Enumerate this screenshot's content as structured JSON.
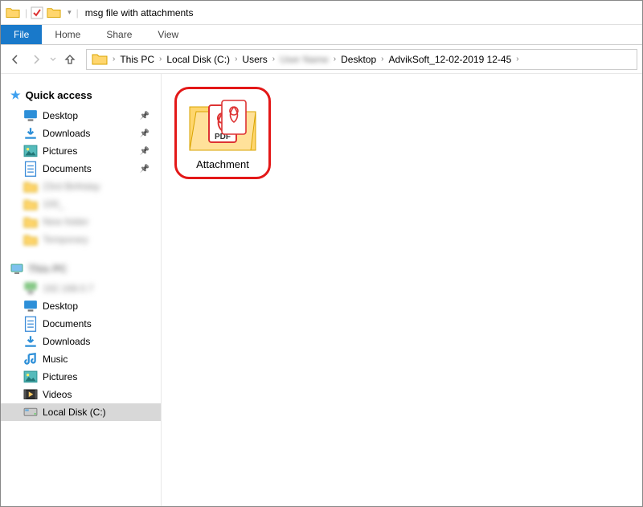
{
  "window": {
    "title": "msg file with attachments"
  },
  "ribbon": {
    "file": "File",
    "tabs": [
      "Home",
      "Share",
      "View"
    ]
  },
  "breadcrumbs": [
    {
      "label": "This PC",
      "blurred": false
    },
    {
      "label": "Local Disk (C:)",
      "blurred": false
    },
    {
      "label": "Users",
      "blurred": false
    },
    {
      "label": "User Name",
      "blurred": true
    },
    {
      "label": "Desktop",
      "blurred": false
    },
    {
      "label": "AdvikSoft_12-02-2019 12-45",
      "blurred": false
    }
  ],
  "sidebar": {
    "quick_access": {
      "title": "Quick access",
      "items": [
        {
          "label": "Desktop",
          "icon": "monitor",
          "pinned": true,
          "blurred": false
        },
        {
          "label": "Downloads",
          "icon": "download",
          "pinned": true,
          "blurred": false
        },
        {
          "label": "Pictures",
          "icon": "pictures",
          "pinned": true,
          "blurred": false
        },
        {
          "label": "Documents",
          "icon": "documents",
          "pinned": true,
          "blurred": false
        },
        {
          "label": "23rd Birthday",
          "icon": "folder",
          "pinned": false,
          "blurred": true
        },
        {
          "label": "100_",
          "icon": "folder",
          "pinned": false,
          "blurred": true
        },
        {
          "label": "New folder",
          "icon": "folder",
          "pinned": false,
          "blurred": true
        },
        {
          "label": "Temporary",
          "icon": "folder",
          "pinned": false,
          "blurred": true
        }
      ]
    },
    "this_pc": {
      "title": "This PC",
      "blurred_title": true,
      "items": [
        {
          "label": "192.168.0.7",
          "icon": "network",
          "blurred": true
        },
        {
          "label": "Desktop",
          "icon": "monitor",
          "blurred": false
        },
        {
          "label": "Documents",
          "icon": "documents",
          "blurred": false
        },
        {
          "label": "Downloads",
          "icon": "download",
          "blurred": false
        },
        {
          "label": "Music",
          "icon": "music",
          "blurred": false
        },
        {
          "label": "Pictures",
          "icon": "pictures",
          "blurred": false
        },
        {
          "label": "Videos",
          "icon": "videos",
          "blurred": false
        },
        {
          "label": "Local Disk (C:)",
          "icon": "disk",
          "blurred": false,
          "selected": true
        }
      ]
    }
  },
  "content": {
    "items": [
      {
        "label": "Attachment",
        "type": "folder-pdf",
        "highlighted": true
      }
    ]
  }
}
